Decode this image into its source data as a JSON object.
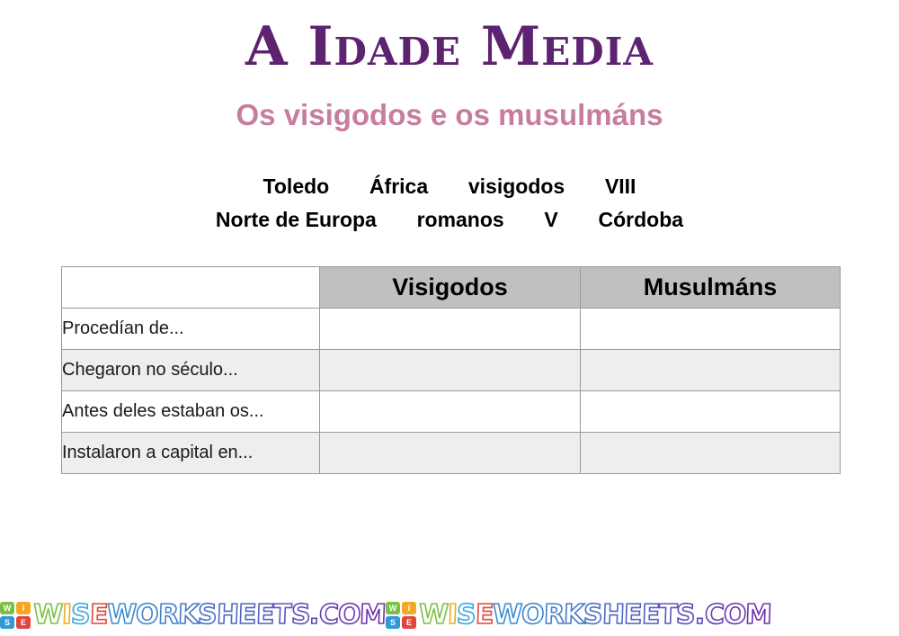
{
  "worksheet": {
    "title": "A Idade Media",
    "subtitle": "Os visigodos e os musulmáns"
  },
  "word_bank": {
    "line1": "Toledo       África       visigodos       VIII",
    "line2": "Norte de Europa       romanos       V       Córdoba",
    "words": [
      "Toledo",
      "África",
      "visigodos",
      "VIII",
      "Norte de Europa",
      "romanos",
      "V",
      "Córdoba"
    ]
  },
  "table": {
    "headers": [
      "",
      "Visigodos",
      "Musulmáns"
    ],
    "rows": [
      {
        "label": "Procedían de...",
        "visigodos": "",
        "musulmans": ""
      },
      {
        "label": "Chegaron no século...",
        "visigodos": "",
        "musulmans": ""
      },
      {
        "label": "Antes deles estaban os...",
        "visigodos": "",
        "musulmans": ""
      },
      {
        "label": "Instalaron a capital en...",
        "visigodos": "",
        "musulmans": ""
      }
    ]
  },
  "footer": {
    "logo_letters": [
      "W",
      "I",
      "S",
      "E"
    ],
    "brand": "WISEWORKSHEETS.COM",
    "repeats": 2
  },
  "colors": {
    "title": "#5e2370",
    "subtitle": "#c87d9e",
    "header_bg": "#c0c0c0",
    "row_alt_bg": "#eeeeee",
    "border": "#9a9a9a",
    "logo_w": "#7ac143",
    "logo_i": "#f5a623",
    "logo_s": "#2e9bd6",
    "logo_e": "#e2453c"
  }
}
